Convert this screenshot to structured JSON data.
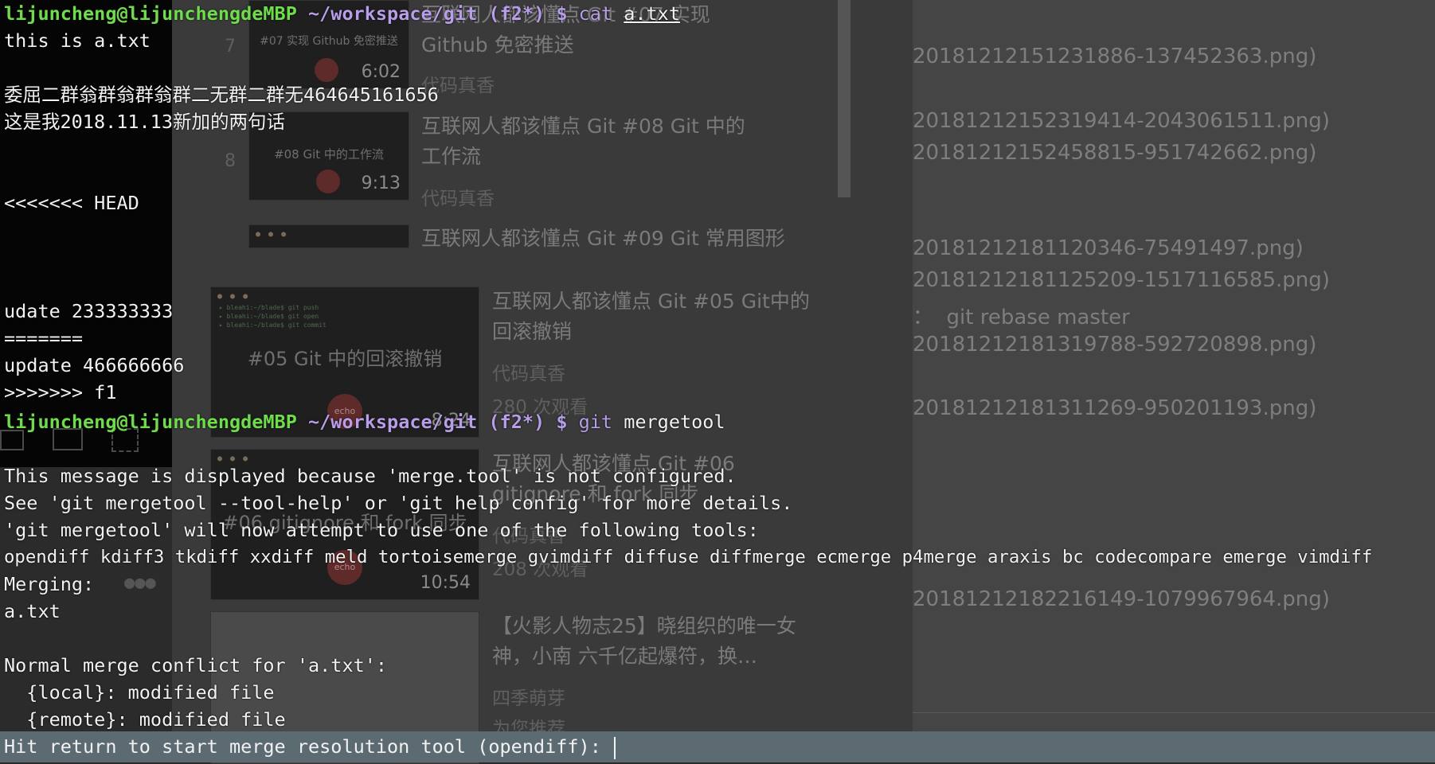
{
  "background": {
    "videos_top": [
      {
        "num": "7",
        "thumb_title": "#07 实现 Github 免密推送",
        "duration": "6:02",
        "title": "互联网人都该懂点 Git #07 实现 Github 免密推送",
        "author": "代码真香"
      },
      {
        "num": "8",
        "thumb_title": "#08 Git 中的工作流",
        "duration": "9:13",
        "title": "互联网人都该懂点 Git #08 Git 中的工作流",
        "author": "代码真香"
      },
      {
        "num": "",
        "thumb_title": "",
        "duration": "",
        "title": "互联网人都该懂点 Git #09 Git 常用图形",
        "author": ""
      }
    ],
    "videos_main": [
      {
        "thumb_title": "#05 Git 中的回滚撤销",
        "duration": "8:24",
        "badge": "echo",
        "title": "互联网人都该懂点 Git #05 Git中的回滚撤销",
        "author": "代码真香",
        "views": "280 次观看"
      },
      {
        "thumb_title": "#06 gitignore 和 fork 同步",
        "duration": "10:54",
        "badge": "echo",
        "title": "互联网人都该懂点 Git #06 gitignore 和 fork 同步",
        "author": "代码真香",
        "views": "208 次观看"
      },
      {
        "thumb_title": "",
        "duration": "",
        "badge": "",
        "title": "【火影人物志25】晓组织的唯一女神，小南 六千亿起爆符，换…",
        "author": "四季萌芽",
        "views": "为您推荐"
      }
    ],
    "files": [
      "20181212151231886-137452363.png)",
      "20181212152319414-2043061511.png)",
      "20181212152458815-951742662.png)",
      "20181212181120346-75491497.png)",
      "20181212181125209-1517116585.png)",
      "：  git rebase master",
      "20181212181319788-592720898.png)",
      "20181212181311269-950201193.png)",
      "20181212182216149-1079967964.png)"
    ]
  },
  "terminal": {
    "prompt1": {
      "user": "lijuncheng@lijunchengdeMBP",
      "path": "~/workspace/git",
      "branch": "(f2*)",
      "dollar": "$",
      "cmd": "cat",
      "arg": "a.txt"
    },
    "lines_a": [
      "this is a.txt",
      "",
      "委屈二群翁群翁群翁群二无群二群无464645161656",
      "这是我2018.11.13新加的两句话",
      "",
      "",
      "<<<<<<< HEAD",
      "",
      "",
      "",
      "udate 233333333",
      "=======",
      "update 466666666",
      ">>>>>>> f1"
    ],
    "prompt2": {
      "user": "lijuncheng@lijunchengdeMBP",
      "path": "~/workspace/git",
      "branch": "(f2*)",
      "dollar": "$",
      "cmd": "git",
      "arg": "mergetool"
    },
    "lines_b": [
      "",
      "This message is displayed because 'merge.tool' is not configured.",
      "See 'git mergetool --tool-help' or 'git help config' for more details.",
      "'git mergetool' will now attempt to use one of the following tools:",
      "opendiff kdiff3 tkdiff xxdiff meld tortoisemerge gvimdiff diffuse diffmerge ecmerge p4merge araxis bc codecompare emerge vimdiff",
      "Merging:",
      "a.txt",
      "",
      "Normal merge conflict for 'a.txt':",
      "  {local}: modified file",
      "  {remote}: modified file"
    ],
    "input_prompt": "Hit return to start merge resolution tool (opendiff): "
  }
}
